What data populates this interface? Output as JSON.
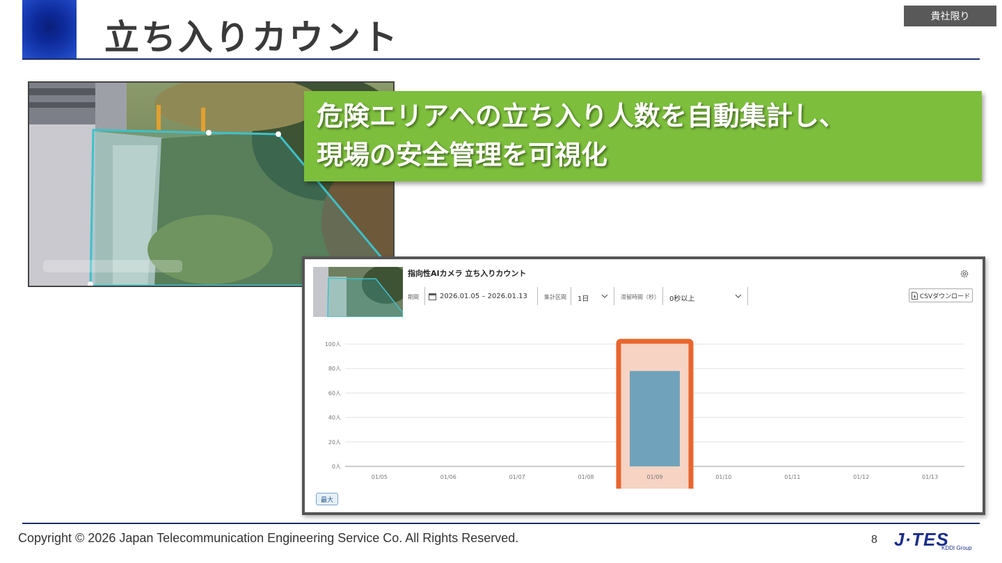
{
  "header": {
    "title": "立ち入りカウント",
    "badge": "貴社限り"
  },
  "headline": {
    "line1": "危険エリアへの立ち入り人数を自動集計し、",
    "line2": "現場の安全管理を可視化"
  },
  "app": {
    "title": "指向性AIカメラ 立ち入りカウント",
    "filters": {
      "period_label": "期間",
      "period_value": "2026.01.05 – 2026.01.13",
      "interval_label": "集計区間",
      "interval_value": "1日",
      "dwell_label": "滞留時間（秒）",
      "dwell_value": "0秒以上"
    },
    "csv_button": "CSVダウンロード",
    "max_button": "最大",
    "icons": {
      "calendar": "calendar-icon",
      "settings": "gear-icon",
      "download": "document-icon",
      "dropdown": "chevron-down-icon"
    }
  },
  "chart_data": {
    "type": "bar",
    "categories": [
      "01/05",
      "01/06",
      "01/07",
      "01/08",
      "01/09",
      "01/10",
      "01/11",
      "01/12",
      "01/13"
    ],
    "values": [
      0,
      0,
      0,
      0,
      78,
      0,
      0,
      0,
      0
    ],
    "y_tick_labels": [
      "0人",
      "20人",
      "40人",
      "60人",
      "80人",
      "100人"
    ],
    "ylim": [
      0,
      100
    ],
    "grid": true,
    "bar_color": "#70a3bb",
    "highlight": {
      "category": "01/09",
      "color": "#e8662f"
    }
  },
  "footer": {
    "copyright": "Copyright © 2026 Japan Telecommunication Engineering Service Co. All Rights Reserved.",
    "page_number": "8",
    "brand": "J·TES",
    "brand_sub": "KDDI Group"
  },
  "colors": {
    "title_rule": "#1b2d6b",
    "headline_bg": "#7dbe3c",
    "logo_blue": "#0d2a9a",
    "area_outline": "#3ec1c9"
  }
}
